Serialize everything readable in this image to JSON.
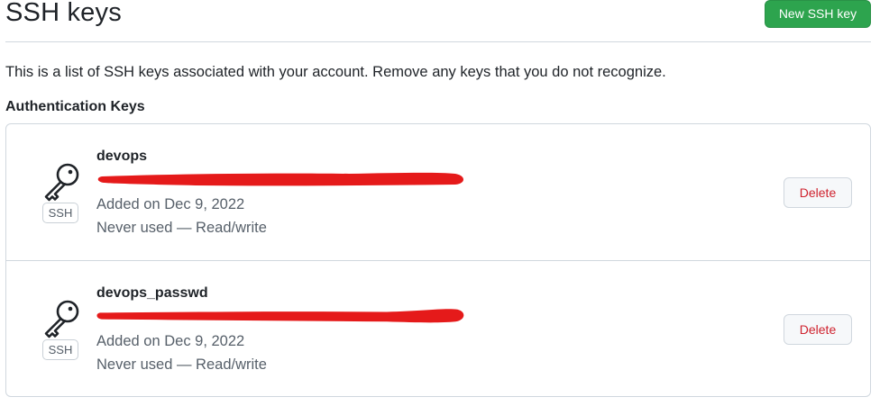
{
  "header": {
    "title": "SSH keys",
    "new_key_label": "New SSH key"
  },
  "intro": "This is a list of SSH keys associated with your account. Remove any keys that you do not recognize.",
  "section_title": "Authentication Keys",
  "keys": [
    {
      "title": "devops",
      "badge": "SSH",
      "added": "Added on Dec 9, 2022",
      "usage": "Never used — Read/write",
      "delete_label": "Delete",
      "fingerprint_redacted": true
    },
    {
      "title": "devops_passwd",
      "badge": "SSH",
      "added": "Added on Dec 9, 2022",
      "usage": "Never used — Read/write",
      "delete_label": "Delete",
      "fingerprint_redacted": true
    }
  ],
  "icons": {
    "key": "key-icon"
  },
  "colors": {
    "primary_button": "#2da44e",
    "danger_text": "#cf222e",
    "redaction": "#e51a1a",
    "border": "#d0d7de",
    "muted_text": "#57606a"
  }
}
